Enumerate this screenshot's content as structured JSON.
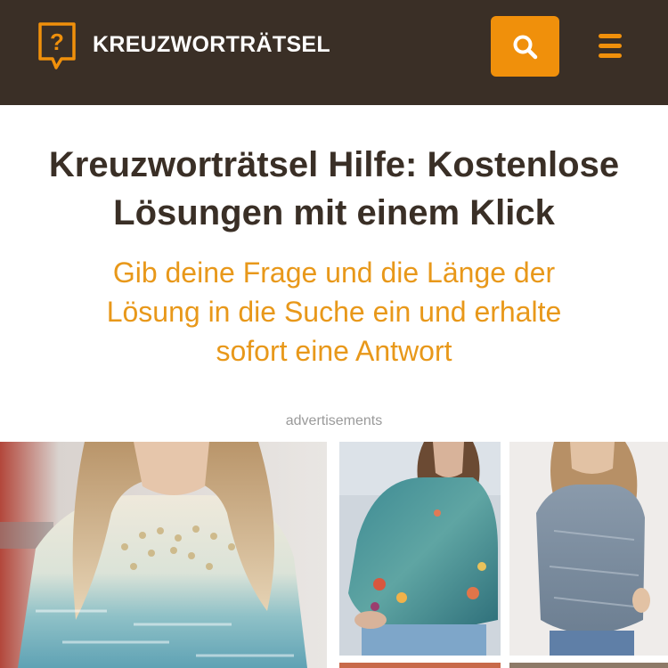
{
  "header": {
    "brand": "KREUZWORTRÄTSEL",
    "logo_icon": "question-speech-bubble-icon",
    "search_icon": "search-icon",
    "menu_icon": "hamburger-menu-icon",
    "colors": {
      "background": "#3a2f26",
      "accent": "#f0900b"
    }
  },
  "hero": {
    "title_line1": "Kreuzworträtsel Hilfe: Kostenlose",
    "title_line2": "Lösungen mit einem Klick",
    "subtitle_line1": "Gib deine Frage und die Länge der",
    "subtitle_line2": "Lösung in die Suche ein und erhalte",
    "subtitle_line3": "sofort eine Antwort",
    "colors": {
      "title": "#3a2f26",
      "subtitle": "#e8981a"
    }
  },
  "ads": {
    "label": "advertisements",
    "adchoices_icon": "adchoices-icon",
    "close_icon": "close-icon",
    "images": [
      "woman-sequin-blouse-image",
      "woman-floral-print-blouse-image",
      "woman-denim-tunic-image"
    ]
  }
}
